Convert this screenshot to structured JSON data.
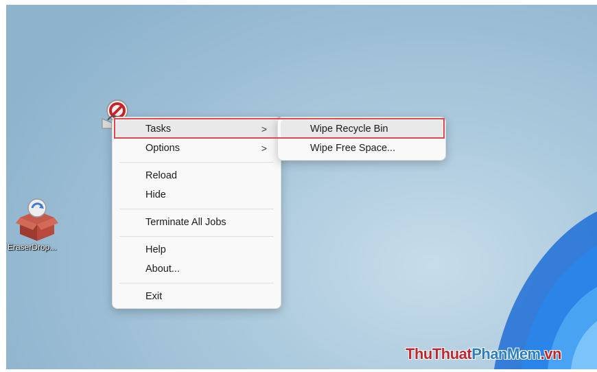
{
  "desktop": {
    "shortcut_label": "EraserDrop...",
    "tray_icon": "eraser-icon",
    "shortcut_icon": "eraser-drop-box-icon"
  },
  "context_menu": {
    "tasks": {
      "label": "Tasks",
      "chevron": ">"
    },
    "options": {
      "label": "Options",
      "chevron": ">"
    },
    "reload": "Reload",
    "hide": "Hide",
    "terminate": "Terminate All Jobs",
    "help": "Help",
    "about": "About...",
    "exit": "Exit"
  },
  "submenu": {
    "wipe_recycle_bin": "Wipe Recycle Bin",
    "wipe_free_space": "Wipe Free Space..."
  },
  "watermark": {
    "part1": "ThuThuat",
    "part2": "PhanMem",
    "part3": ".vn"
  },
  "colors": {
    "highlight_box": "#e0464b",
    "menu_bg": "#f9f9f9",
    "watermark_red": "#c0262d",
    "watermark_blue": "#2b7fc4"
  }
}
